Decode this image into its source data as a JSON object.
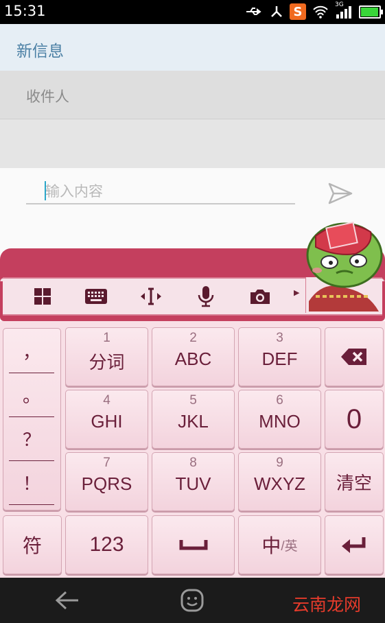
{
  "status_bar": {
    "time": "15:31",
    "network": "3G",
    "app_badge": "S"
  },
  "header": {
    "title": "新信息"
  },
  "recipient": {
    "placeholder": "收件人"
  },
  "compose": {
    "placeholder": "输入内容"
  },
  "toolbar": {
    "items": [
      "grid-menu-icon",
      "keyboard-icon",
      "cursor-icon",
      "microphone-icon",
      "camera-icon"
    ],
    "collapse_icon": "chevron-down-icon"
  },
  "keyboard": {
    "punctuation": [
      "，",
      "。",
      "？",
      "！"
    ],
    "rows": [
      [
        {
          "num": "1",
          "label": "分词"
        },
        {
          "num": "2",
          "label": "ABC"
        },
        {
          "num": "3",
          "label": "DEF"
        }
      ],
      [
        {
          "num": "4",
          "label": "GHI"
        },
        {
          "num": "5",
          "label": "JKL"
        },
        {
          "num": "6",
          "label": "MNO"
        }
      ],
      [
        {
          "num": "7",
          "label": "PQRS"
        },
        {
          "num": "8",
          "label": "TUV"
        },
        {
          "num": "9",
          "label": "WXYZ"
        }
      ]
    ],
    "side": {
      "zero": "0",
      "clear": "清空"
    },
    "bottom": {
      "symbols": "符",
      "numbers": "123",
      "lang_main": "中",
      "lang_sub": "/英"
    }
  },
  "watermark": {
    "text": "云南龙网"
  },
  "colors": {
    "accent": "#c43f5e",
    "key_text": "#6a1f3a",
    "title_blue": "#4a7fa4"
  }
}
